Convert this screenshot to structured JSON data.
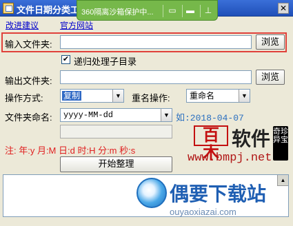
{
  "window": {
    "title": "文件日期分类工",
    "close_glyph": "✕"
  },
  "sandbox_bar": {
    "text": "360隔离沙箱保护中...",
    "icons": [
      "collapse-icon",
      "folder-icon",
      "pin-icon"
    ]
  },
  "links": {
    "suggestion": "改进建议",
    "website": "官方网站"
  },
  "input_folder": {
    "label": "输入文件夹:",
    "value": "",
    "browse_label": "浏览"
  },
  "recursive": {
    "label": "递归处理子目录",
    "checked": true,
    "check_glyph": "✔"
  },
  "output_folder": {
    "label": "输出文件夹:",
    "value": "",
    "browse_label": "浏览"
  },
  "operation": {
    "label": "操作方式:",
    "value": "复制",
    "rename_label": "重名操作:",
    "rename_value": "重命名"
  },
  "naming": {
    "label": "文件夹命名:",
    "value": "yyyy-MM-dd",
    "example": "如:2018-04-07"
  },
  "note": "注: 年:y 月:M 日:d 时:H 分:m 秒:s",
  "start_label": "开始整理",
  "watermark": {
    "badge": "百木",
    "text": "软件",
    "stamp": "奇珍异宝",
    "url": "www.bmpj.net"
  },
  "brand": {
    "name": "偶要下载站",
    "url": "ouyaoxiazai.com"
  },
  "colors": {
    "highlight": "#e0403a",
    "link": "#0000cc",
    "note": "#e02020",
    "example": "#2a6fc0"
  }
}
